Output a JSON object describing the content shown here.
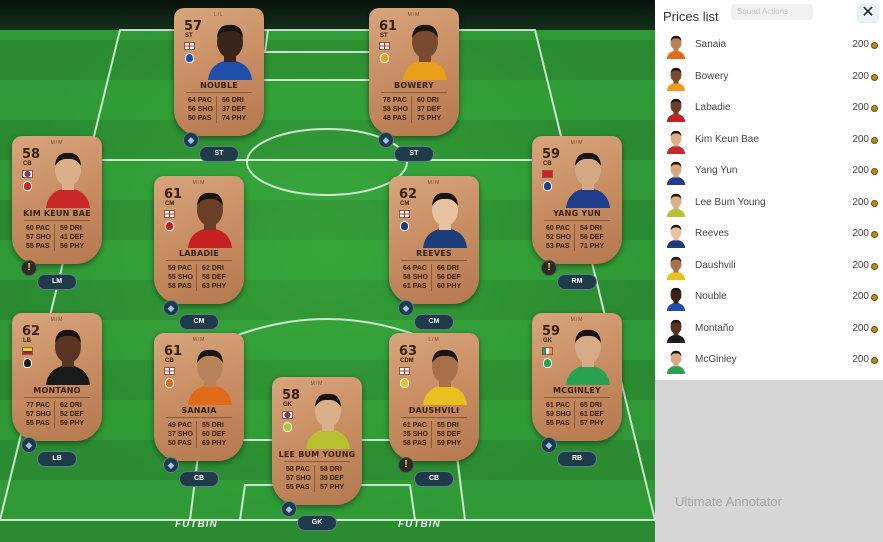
{
  "pitch": {
    "brand_left": "FUTBIN",
    "brand_right": "FUTBIN"
  },
  "cards": [
    {
      "id": "nouble",
      "rating": "57",
      "position": "ST",
      "top_mark": "L/L",
      "name": "NOUBLE",
      "flag": "england",
      "skin": "#3a2418",
      "shirt": "#1f4fa8",
      "stats_left": [
        "64 PAC",
        "56 SHO",
        "50 PAS"
      ],
      "stats_right": [
        "56 DRI",
        "37 DEF",
        "74 PHY"
      ],
      "slot": "ST",
      "icon": "chem"
    },
    {
      "id": "bowery",
      "rating": "61",
      "position": "ST",
      "top_mark": "M/M",
      "name": "BOWERY",
      "flag": "england",
      "skin": "#7a4a30",
      "shirt": "#e8a01a",
      "stats_left": [
        "78 PAC",
        "58 SHO",
        "48 PAS"
      ],
      "stats_right": [
        "60 DRI",
        "37 DEF",
        "75 PHY"
      ],
      "slot": "ST",
      "icon": "chem"
    },
    {
      "id": "kim",
      "rating": "58",
      "position": "CB",
      "top_mark": "M/M",
      "name": "KIM KEUN BAE",
      "flag": "korea",
      "skin": "#d9b08a",
      "shirt": "#c82828",
      "stats_left": [
        "60 PAC",
        "57 SHO",
        "55 PAS"
      ],
      "stats_right": [
        "59 DRI",
        "41 DEF",
        "56 PHY"
      ],
      "slot": "LM",
      "icon": "warn"
    },
    {
      "id": "labadie",
      "rating": "61",
      "position": "CM",
      "top_mark": "M/M",
      "name": "LABADIE",
      "flag": "england",
      "skin": "#6a3f28",
      "shirt": "#c42020",
      "stats_left": [
        "59 PAC",
        "55 SHO",
        "58 PAS"
      ],
      "stats_right": [
        "62 DRI",
        "58 DEF",
        "63 PHY"
      ],
      "slot": "CM",
      "icon": "chem"
    },
    {
      "id": "reeves",
      "rating": "62",
      "position": "CM",
      "top_mark": "M/M",
      "name": "REEVES",
      "flag": "england",
      "skin": "#e7c2a0",
      "shirt": "#1c3c7a",
      "stats_left": [
        "64 PAC",
        "58 SHO",
        "61 PAS"
      ],
      "stats_right": [
        "66 DRI",
        "56 DEF",
        "60 PHY"
      ],
      "slot": "CM",
      "icon": "chem"
    },
    {
      "id": "yang",
      "rating": "59",
      "position": "CB",
      "top_mark": "M/M",
      "name": "YANG YUN",
      "flag": "china",
      "skin": "#d4a882",
      "shirt": "#1f3d8a",
      "stats_left": [
        "60 PAC",
        "52 SHO",
        "53 PAS"
      ],
      "stats_right": [
        "54 DRI",
        "56 DEF",
        "71 PHY"
      ],
      "slot": "RM",
      "icon": "warn"
    },
    {
      "id": "montano",
      "rating": "62",
      "position": "LB",
      "top_mark": "M/M",
      "name": "MONTANO",
      "flag": "colombia",
      "skin": "#5a3422",
      "shirt": "#1a1a1a",
      "stats_left": [
        "77 PAC",
        "57 SHO",
        "55 PAS"
      ],
      "stats_right": [
        "62 DRI",
        "52 DEF",
        "59 PHY"
      ],
      "slot": "LB",
      "icon": "chem"
    },
    {
      "id": "sanaia",
      "rating": "61",
      "position": "CB",
      "top_mark": "M/M",
      "name": "SANAIA",
      "flag": "georgia",
      "skin": "#b8825a",
      "shirt": "#e06a1a",
      "stats_left": [
        "49 PAC",
        "37 SHO",
        "50 PAS"
      ],
      "stats_right": [
        "55 DRI",
        "60 DEF",
        "69 PHY"
      ],
      "slot": "CB",
      "icon": "chem"
    },
    {
      "id": "lee",
      "rating": "58",
      "position": "GK",
      "top_mark": "M/M",
      "name": "LEE BUM YOUNG",
      "flag": "korea",
      "skin": "#d9b08a",
      "shirt": "#b8c030",
      "stats_left": [
        "58 PAC",
        "57 SHO",
        "55 PAS"
      ],
      "stats_right": [
        "58 DRI",
        "39 DEF",
        "57 PHY"
      ],
      "slot": "GK",
      "icon": "chem"
    },
    {
      "id": "daushvili",
      "rating": "63",
      "position": "CDM",
      "top_mark": "L/M",
      "name": "DAUSHVILI",
      "flag": "georgia",
      "skin": "#a8704a",
      "shirt": "#e8c020",
      "stats_left": [
        "61 PAC",
        "35 SHO",
        "58 PAS"
      ],
      "stats_right": [
        "55 DRI",
        "58 DEF",
        "59 PHY"
      ],
      "slot": "CB",
      "icon": "warn"
    },
    {
      "id": "mcginley",
      "rating": "59",
      "position": "GK",
      "top_mark": "M/M",
      "name": "MCGINLEY",
      "flag": "ireland",
      "skin": "#d7ab88",
      "shirt": "#2aa050",
      "stats_left": [
        "61 PAC",
        "59 SHO",
        "55 PAS"
      ],
      "stats_right": [
        "65 DRI",
        "61 DEF",
        "57 PHY"
      ],
      "slot": "RB",
      "icon": "chem"
    }
  ],
  "panel": {
    "title": "Prices list",
    "ghost_tab": "Squad Actions",
    "close_label": "✕",
    "ghost_lower_title": "Ultimate Annotator",
    "coin_icon": "coin-icon",
    "items": [
      {
        "name": "Sanaia",
        "price": "200",
        "skin": "#b8825a",
        "shirt": "#e06a1a"
      },
      {
        "name": "Bowery",
        "price": "200",
        "skin": "#7a4a30",
        "shirt": "#e8a01a"
      },
      {
        "name": "Labadie",
        "price": "200",
        "skin": "#6a3f28",
        "shirt": "#c42020"
      },
      {
        "name": "Kim Keun Bae",
        "price": "200",
        "skin": "#d9b08a",
        "shirt": "#c82828"
      },
      {
        "name": "Yang Yun",
        "price": "200",
        "skin": "#d4a882",
        "shirt": "#1f3d8a"
      },
      {
        "name": "Lee Bum Young",
        "price": "200",
        "skin": "#d9b08a",
        "shirt": "#b8c030"
      },
      {
        "name": "Reeves",
        "price": "200",
        "skin": "#e7c2a0",
        "shirt": "#1c3c7a"
      },
      {
        "name": "Daushvili",
        "price": "200",
        "skin": "#a8704a",
        "shirt": "#e8c020"
      },
      {
        "name": "Nouble",
        "price": "200",
        "skin": "#3a2418",
        "shirt": "#1f4fa8"
      },
      {
        "name": "Montaño",
        "price": "200",
        "skin": "#5a3422",
        "shirt": "#1a1a1a"
      },
      {
        "name": "McGinley",
        "price": "200",
        "skin": "#d7ab88",
        "shirt": "#2aa050"
      }
    ]
  }
}
